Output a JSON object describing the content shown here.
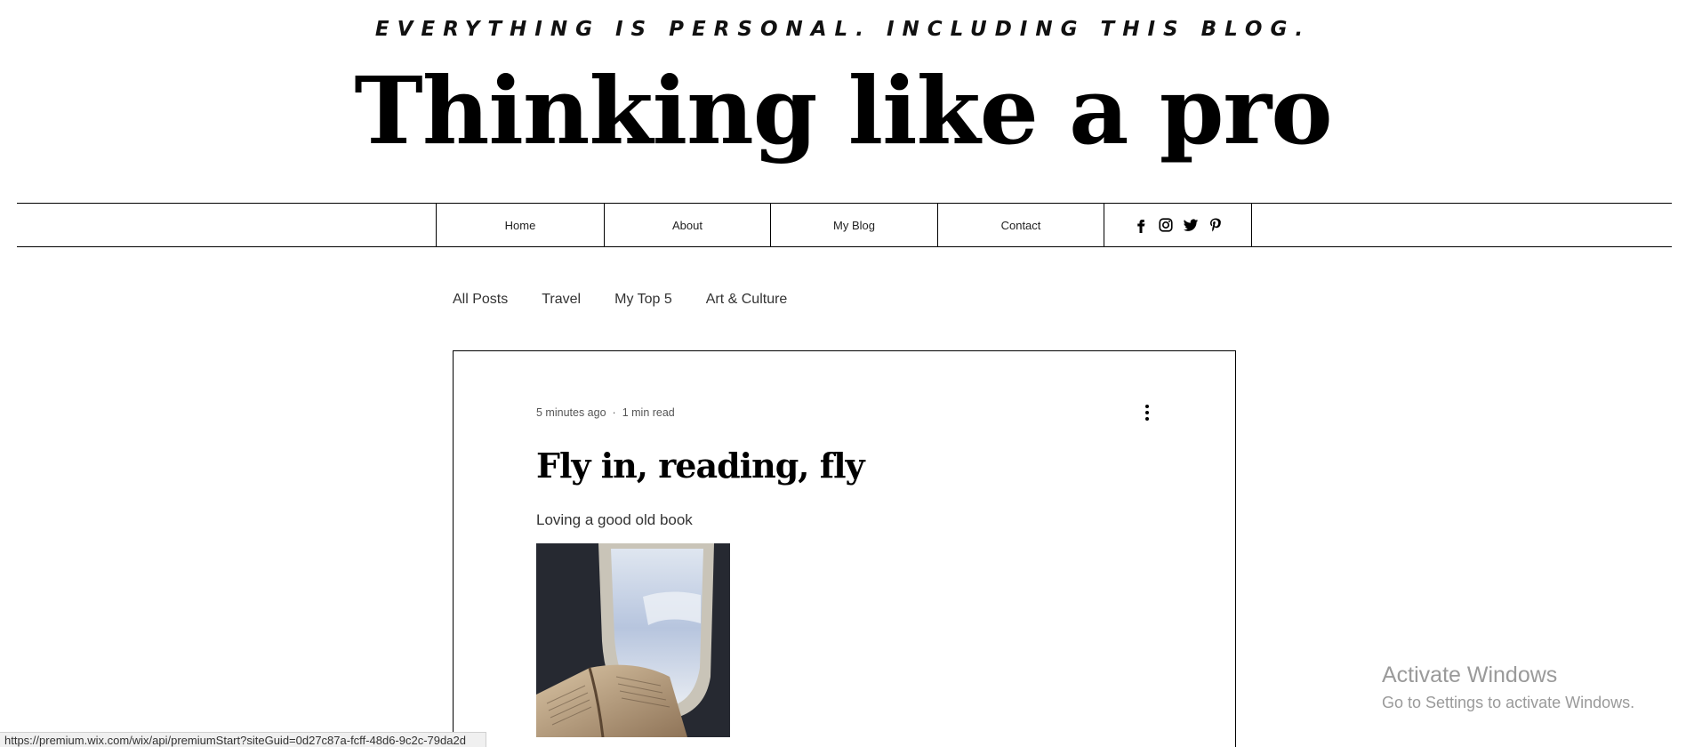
{
  "header": {
    "tagline": "EVERYTHING IS PERSONAL. INCLUDING THIS BLOG.",
    "title": "Thinking like a pro"
  },
  "menu": {
    "items": [
      {
        "label": "Home"
      },
      {
        "label": "About"
      },
      {
        "label": "My Blog"
      },
      {
        "label": "Contact"
      }
    ],
    "social_icons": [
      "facebook-icon",
      "instagram-icon",
      "twitter-icon",
      "pinterest-icon"
    ]
  },
  "categories": [
    "All Posts",
    "Travel",
    "My Top 5",
    "Art & Culture"
  ],
  "post": {
    "time_ago": "5 minutes ago",
    "separator": "·",
    "read_time": "1 min read",
    "title": "Fly in, reading, fly",
    "subtitle": "Loving a good old book",
    "more_icon": "more-vertical-icon"
  },
  "watermark": {
    "line1": "Activate Windows",
    "line2": "Go to Settings to activate Windows."
  },
  "status_bar": {
    "url": "https://premium.wix.com/wix/api/premiumStart?siteGuid=0d27c87a-fcff-48d6-9c2c-79da2d"
  }
}
